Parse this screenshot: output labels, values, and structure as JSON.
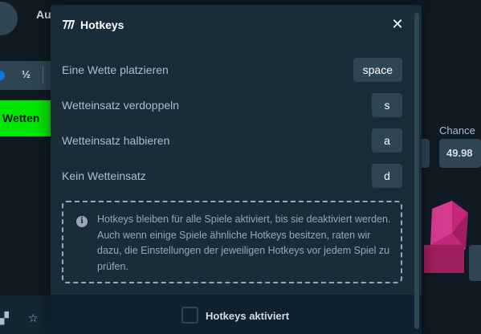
{
  "background": {
    "top_button_label": "Au",
    "half_label": "½",
    "bet_button_label": "Wetten",
    "chance_label": "Chance",
    "chance_value": "49.98"
  },
  "modal": {
    "title": "Hotkeys",
    "close_icon": "close-icon",
    "hotkeys": [
      {
        "label": "Eine Wette platzieren",
        "key": "space"
      },
      {
        "label": "Wetteinsatz verdoppeln",
        "key": "s"
      },
      {
        "label": "Wetteinsatz halbieren",
        "key": "a"
      },
      {
        "label": "Kein Wetteinsatz",
        "key": "d"
      }
    ],
    "info_text": "Hotkeys bleiben für alle Spiele aktiviert, bis sie deaktiviert werden. Auch wenn einige Spiele ähnliche Hotkeys besitzen, raten wir dazu, die Einstellungen der jeweiligen Hotkeys vor jedem Spiel zu prüfen.",
    "checkbox_label": "Hotkeys aktiviert",
    "checkbox_checked": false
  },
  "colors": {
    "modal_bg": "#1a2c38",
    "footer_bg": "#0f212e",
    "key_bg": "#2f4553",
    "text_muted": "#b1bad3",
    "bet_green": "#00e701",
    "gem_pink": "#c4277a"
  }
}
